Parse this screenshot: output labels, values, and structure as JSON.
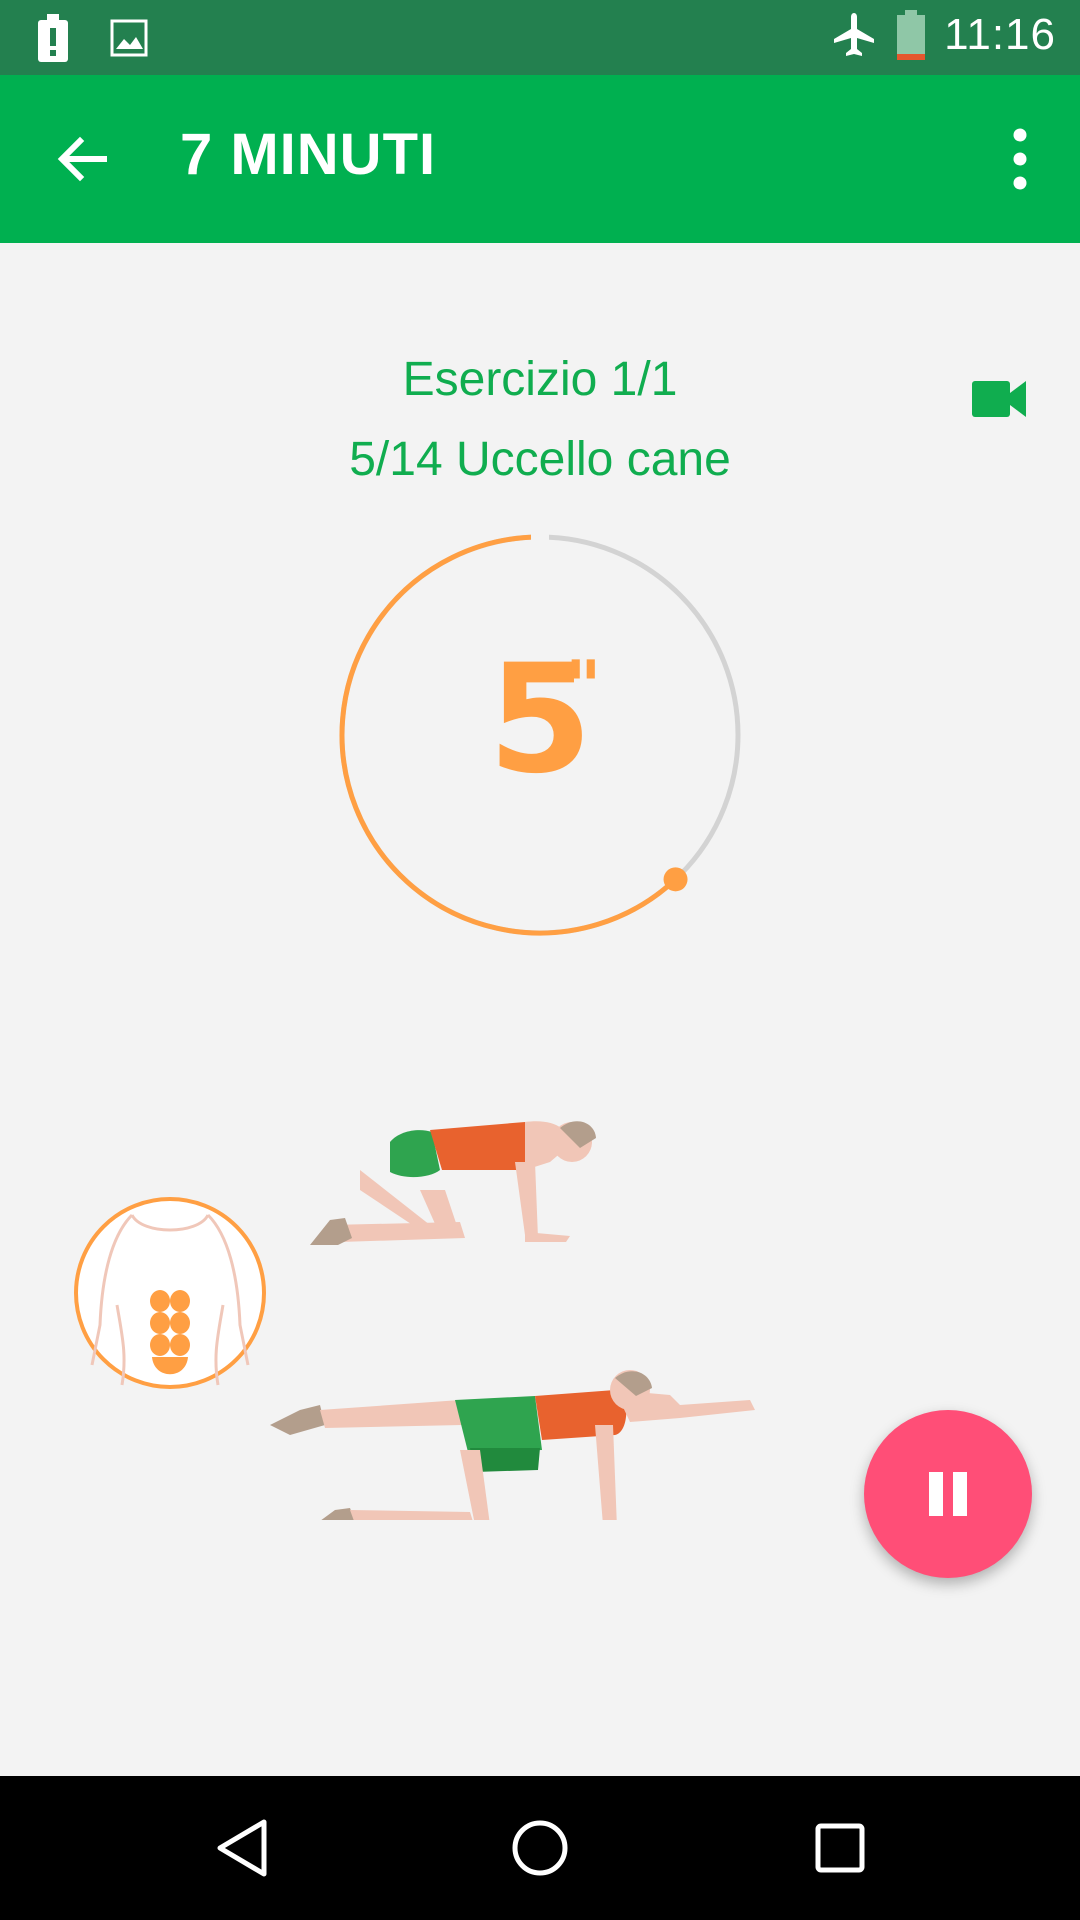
{
  "status_bar": {
    "time": "11:16",
    "icons": [
      "alert-icon",
      "image-icon",
      "airplane-icon",
      "battery-icon"
    ]
  },
  "app_bar": {
    "title": "7 MINUTI",
    "back_icon": "arrow-back-icon",
    "more_icon": "more-vert-icon"
  },
  "exercise": {
    "count": "Esercizio 1/1",
    "name": "5/14 Uccello cane",
    "video_icon": "videocam-icon"
  },
  "timer": {
    "value": "5",
    "unit": "\"",
    "progress": 0.62
  },
  "controls": {
    "pause_icon": "pause-icon"
  },
  "nav_bar": {
    "icons": [
      "back-triangle-icon",
      "home-circle-icon",
      "recents-square-icon"
    ]
  },
  "colors": {
    "status_bar": "#23804f",
    "app_bar": "#00b050",
    "accent_text": "#10ad4f",
    "timer": "#ff9f43",
    "fab": "#ff4e77",
    "background": "#f3f3f3"
  }
}
